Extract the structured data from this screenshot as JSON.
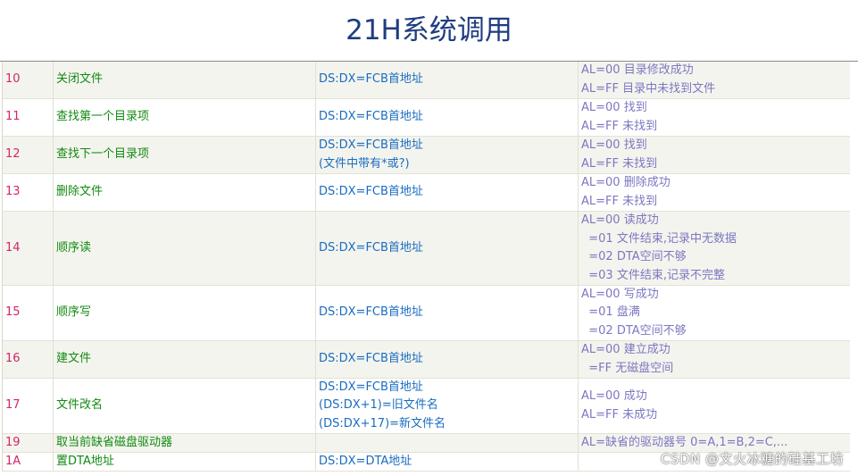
{
  "title": "21H系统调用",
  "rows": [
    {
      "code": "10",
      "name": [
        "关闭文件"
      ],
      "entry": [
        "DS:DX=FCB首地址"
      ],
      "ret": [
        "AL=00 目录修改成功",
        "AL=FF 目录中未找到文件"
      ]
    },
    {
      "code": "11",
      "name": [
        "查找第一个目录项"
      ],
      "entry": [
        "DS:DX=FCB首地址"
      ],
      "ret": [
        "AL=00 找到",
        "AL=FF 未找到"
      ]
    },
    {
      "code": "12",
      "name": [
        "查找下一个目录项"
      ],
      "entry": [
        "DS:DX=FCB首地址",
        "(文件中带有*或?)"
      ],
      "ret": [
        "AL=00 找到",
        "AL=FF 未找到"
      ]
    },
    {
      "code": "13",
      "name": [
        "删除文件"
      ],
      "entry": [
        "DS:DX=FCB首地址"
      ],
      "ret": [
        "AL=00 删除成功",
        "AL=FF 未找到"
      ]
    },
    {
      "code": "14",
      "name": [
        "顺序读"
      ],
      "entry": [
        "DS:DX=FCB首地址"
      ],
      "ret": [
        "AL=00 读成功",
        "  =01 文件结束,记录中无数据",
        "  =02 DTA空间不够",
        "  =03 文件结束,记录不完整"
      ]
    },
    {
      "code": "15",
      "name": [
        "顺序写"
      ],
      "entry": [
        "DS:DX=FCB首地址"
      ],
      "ret": [
        "AL=00 写成功",
        "  =01 盘满",
        "  =02 DTA空间不够"
      ]
    },
    {
      "code": "16",
      "name": [
        "建文件"
      ],
      "entry": [
        "DS:DX=FCB首地址"
      ],
      "ret": [
        "AL=00 建立成功",
        "  =FF 无磁盘空间"
      ]
    },
    {
      "code": "17",
      "name": [
        "文件改名"
      ],
      "entry": [
        "DS:DX=FCB首地址",
        "(DS:DX+1)=旧文件名",
        "(DS:DX+17)=新文件名"
      ],
      "ret": [
        "AL=00 成功",
        "AL=FF 未成功"
      ]
    },
    {
      "code": "19",
      "name": [
        "取当前缺省磁盘驱动器"
      ],
      "entry": [
        ""
      ],
      "ret": [
        "AL=缺省的驱动器号 0=A,1=B,2=C,..."
      ]
    },
    {
      "code": "1A",
      "name": [
        "置DTA地址"
      ],
      "entry": [
        "DS:DX=DTA地址"
      ],
      "ret": [
        ""
      ]
    }
  ],
  "watermark": "CSDN @文火冰糖的硅基工坊"
}
